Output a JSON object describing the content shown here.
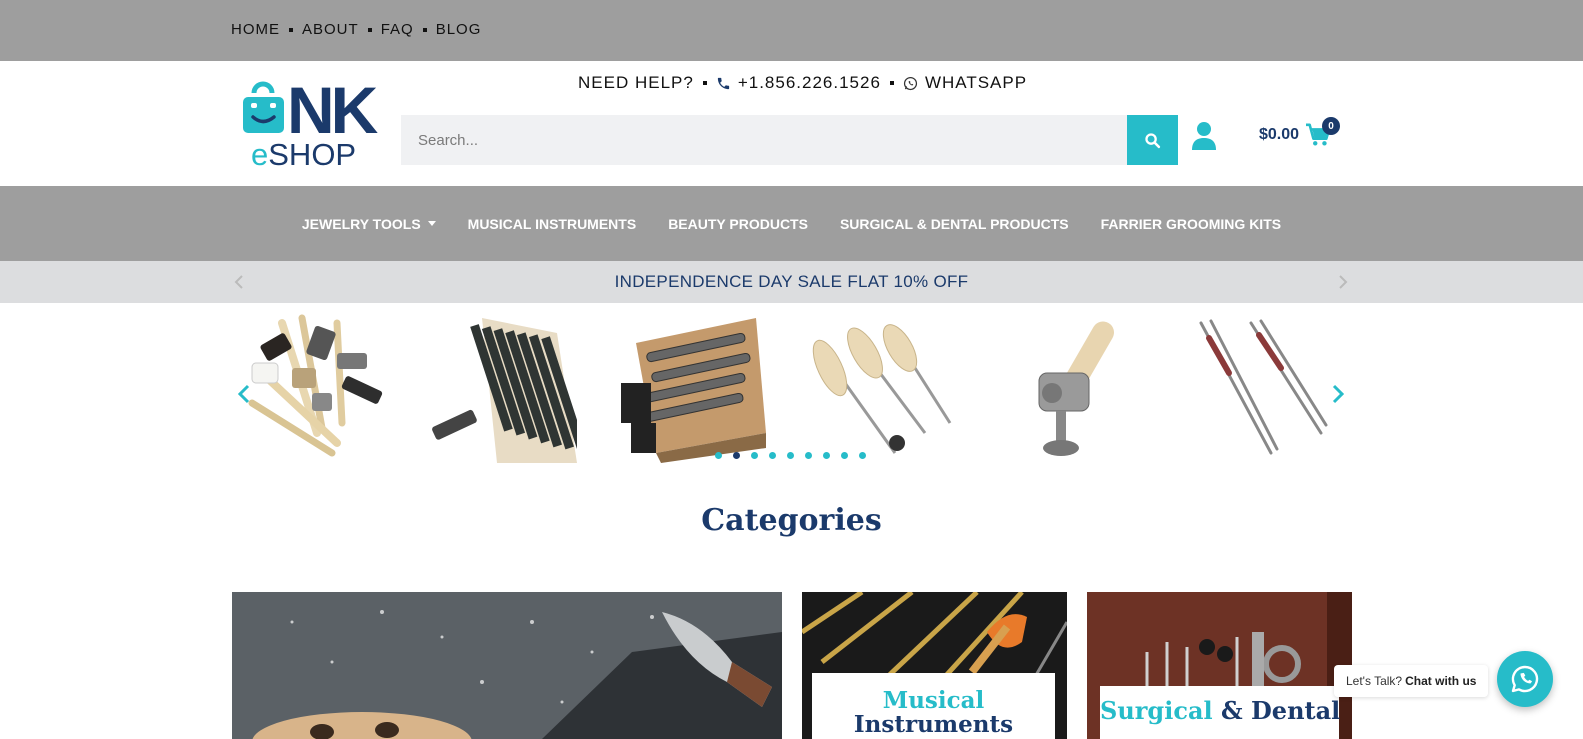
{
  "topnav": {
    "items": [
      "HOME",
      "ABOUT",
      "FAQ",
      "BLOG"
    ]
  },
  "header": {
    "help_label": "NEED HELP?",
    "phone": "+1.856.226.1526",
    "whatsapp": "WHATSAPP",
    "logo_brand": "NK",
    "logo_sub": "eSHOP",
    "search_placeholder": "Search...",
    "cart_total": "$0.00",
    "cart_count": "0"
  },
  "mainnav": {
    "items": [
      {
        "label": "JEWELRY TOOLS",
        "has_dropdown": true
      },
      {
        "label": "MUSICAL INSTRUMENTS",
        "has_dropdown": false
      },
      {
        "label": "BEAUTY PRODUCTS",
        "has_dropdown": false
      },
      {
        "label": "SURGICAL & DENTAL PRODUCTS",
        "has_dropdown": false
      },
      {
        "label": "FARRIER GROOMING KITS",
        "has_dropdown": false
      }
    ]
  },
  "promo": {
    "text": "INDEPENDENCE DAY SALE FLAT 10% OFF"
  },
  "carousel": {
    "dot_count": 9,
    "active_dot": 1
  },
  "categories": {
    "title": "Categories",
    "cards": [
      {
        "line1_teal": "Musical",
        "line2_navy": "Instruments"
      },
      {
        "teal": "Surgical",
        "navy": "& Dental"
      }
    ]
  },
  "chat": {
    "prefix": "Let's Talk?",
    "cta": "Chat with us"
  },
  "colors": {
    "teal": "#26bcc9",
    "navy": "#1b3a6b",
    "gray_bar": "#9e9e9e"
  }
}
